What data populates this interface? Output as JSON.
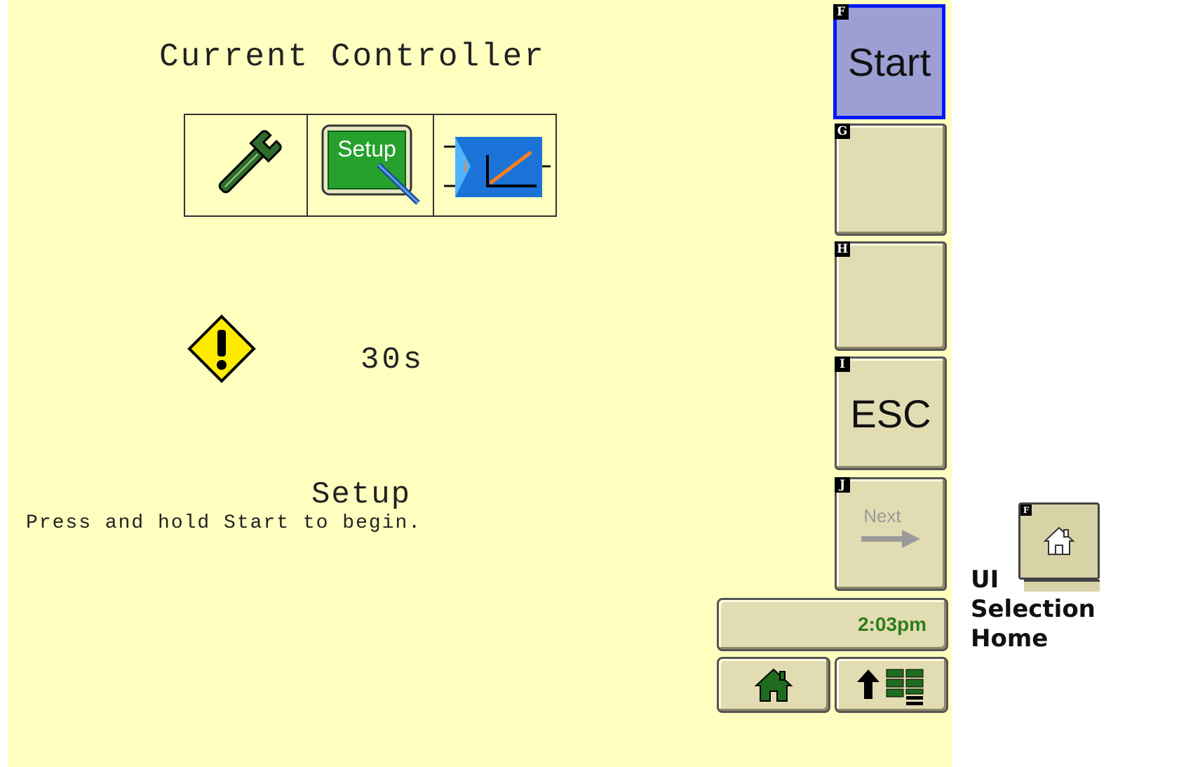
{
  "screen": {
    "title": "Current Controller",
    "icons": [
      "wrench-icon",
      "setup-icon",
      "calibration-icon"
    ],
    "setup_icon_text": "Setup",
    "warning_icon": "warning-icon",
    "countdown": "30s",
    "status": "Setup",
    "instruction": "Press and hold Start to begin."
  },
  "softkeys": [
    {
      "letter": "F",
      "label": "Start"
    },
    {
      "letter": "G",
      "label": ""
    },
    {
      "letter": "H",
      "label": ""
    },
    {
      "letter": "I",
      "label": "ESC"
    },
    {
      "letter": "J",
      "label": "Next"
    }
  ],
  "clock": "2:03pm",
  "bottom_buttons": {
    "home": "home-icon",
    "menu": "up-arrow-menu-icon"
  },
  "side_label": {
    "line1": "UI",
    "line2": "Selection",
    "line3": "Home"
  },
  "thumbnail": {
    "letter": "F",
    "icon": "home-icon"
  },
  "colors": {
    "background": "#ffffc0",
    "softkey": "#e2dcb3",
    "active_key": "#9c9fd3",
    "active_border": "#0018ff",
    "clock_text": "#2e7d1a"
  }
}
